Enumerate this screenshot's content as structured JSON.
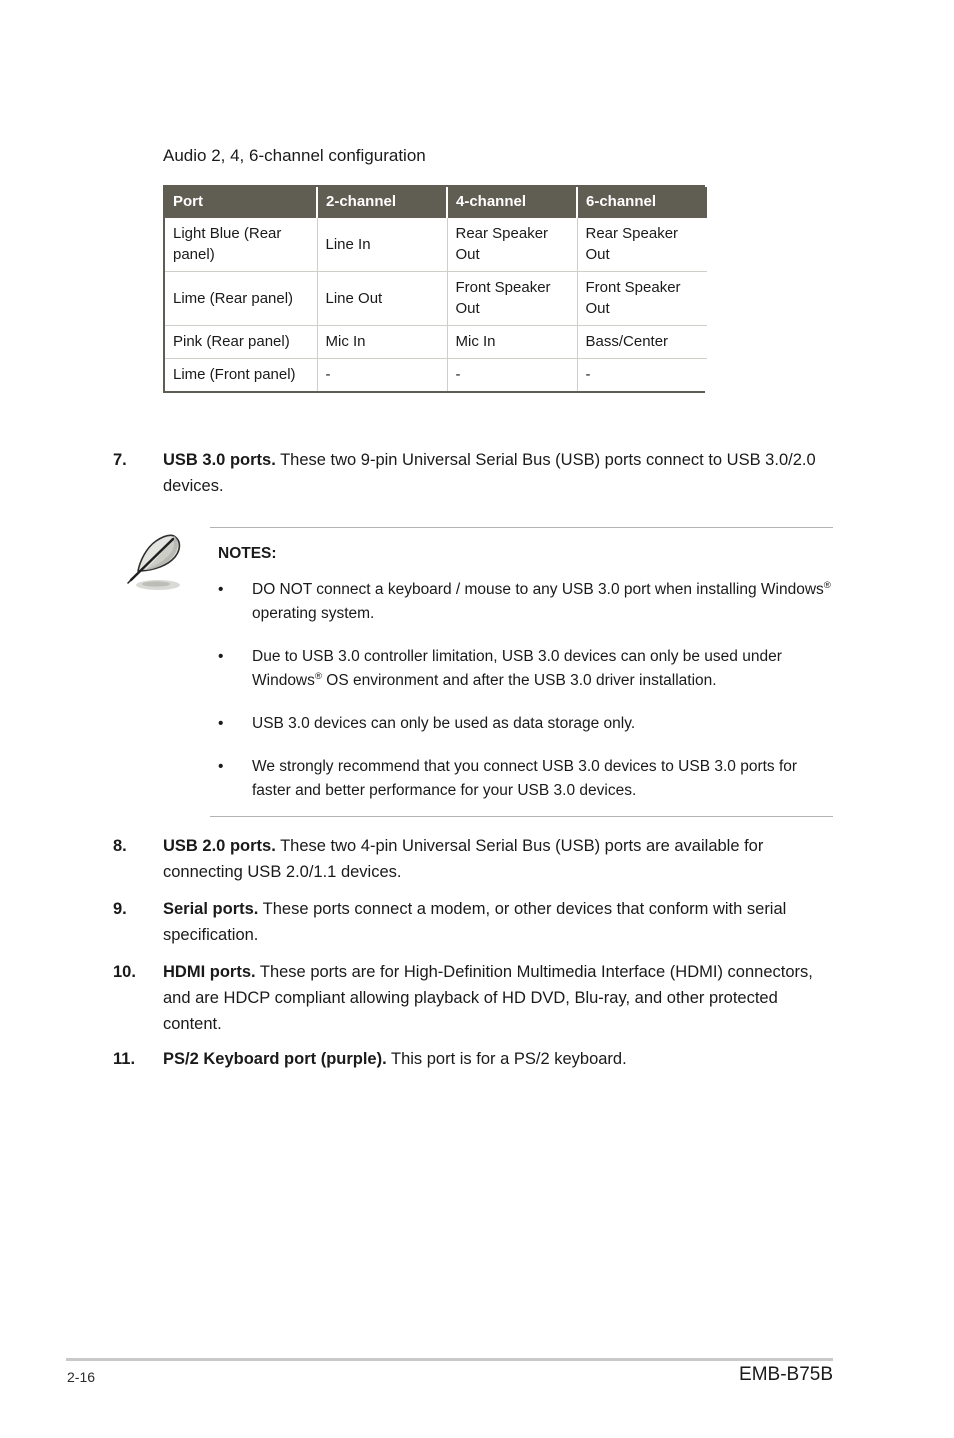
{
  "document": {
    "section_caption": "Audio 2, 4, 6-channel configuration"
  },
  "audio_table": {
    "headers": [
      "Port",
      "2-channel",
      "4-channel",
      "6-channel"
    ],
    "rows": [
      {
        "port": "Light Blue (Rear panel)",
        "ch2": "Line In",
        "ch4": "Rear Speaker Out",
        "ch6": "Rear Speaker Out"
      },
      {
        "port": "Lime (Rear panel)",
        "ch2": "Line Out",
        "ch4": "Front Speaker Out",
        "ch6": "Front Speaker Out"
      },
      {
        "port": "Pink (Rear panel)",
        "ch2": "Mic In",
        "ch4": "Mic In",
        "ch6": "Bass/Center"
      },
      {
        "port": "Lime (Front panel)",
        "ch2": "-",
        "ch4": "-",
        "ch6": "-"
      }
    ],
    "header_bg": "#605d52",
    "header_fg": "#ffffff",
    "border_color": "#5f5c51",
    "inner_border_color": "#cfcfc9"
  },
  "items": [
    {
      "number": "7.",
      "title": "USB 3.0 ports.",
      "text": " These two 9-pin Universal Serial Bus (USB) ports connect to USB 3.0/2.0 devices."
    },
    {
      "number": "8.",
      "title": "USB 2.0 ports.",
      "text": " These two 4-pin Universal Serial Bus (USB) ports are available for connecting USB 2.0/1.1 devices."
    },
    {
      "number": "9.",
      "title": "Serial ports.",
      "text": " These ports connect a modem, or other devices that conform with serial specification."
    },
    {
      "number": "10.",
      "title": "HDMI ports.",
      "text": " These ports are for High-Definition Multimedia Interface (HDMI) connectors, and are HDCP compliant allowing playback of HD DVD, Blu-ray, and other protected content."
    },
    {
      "number": "11.",
      "title": "PS/2 Keyboard port (purple).",
      "text": " This port is for a PS/2 keyboard."
    }
  ],
  "notes": {
    "icon": "feather-quill-icon",
    "title": "NOTES:",
    "bullet_glyph": "•",
    "bullets": [
      {
        "before": "DO NOT connect a keyboard / mouse to any USB 3.0 port when installing Windows",
        "sup": "®",
        "after": " operating system."
      },
      {
        "before": "Due to USB 3.0 controller limitation, USB 3.0 devices can only be used under Windows",
        "sup": "®",
        "after": " OS environment and after the USB 3.0 driver installation."
      },
      {
        "before": "USB 3.0 devices can only be used as data storage only.",
        "sup": "",
        "after": ""
      },
      {
        "before": "We strongly recommend that you connect USB 3.0 devices to USB 3.0 ports for faster and better performance for your USB 3.0 devices.",
        "sup": "",
        "after": ""
      }
    ]
  },
  "footer": {
    "page_number": "2-16",
    "model": "EMB-B75B"
  }
}
